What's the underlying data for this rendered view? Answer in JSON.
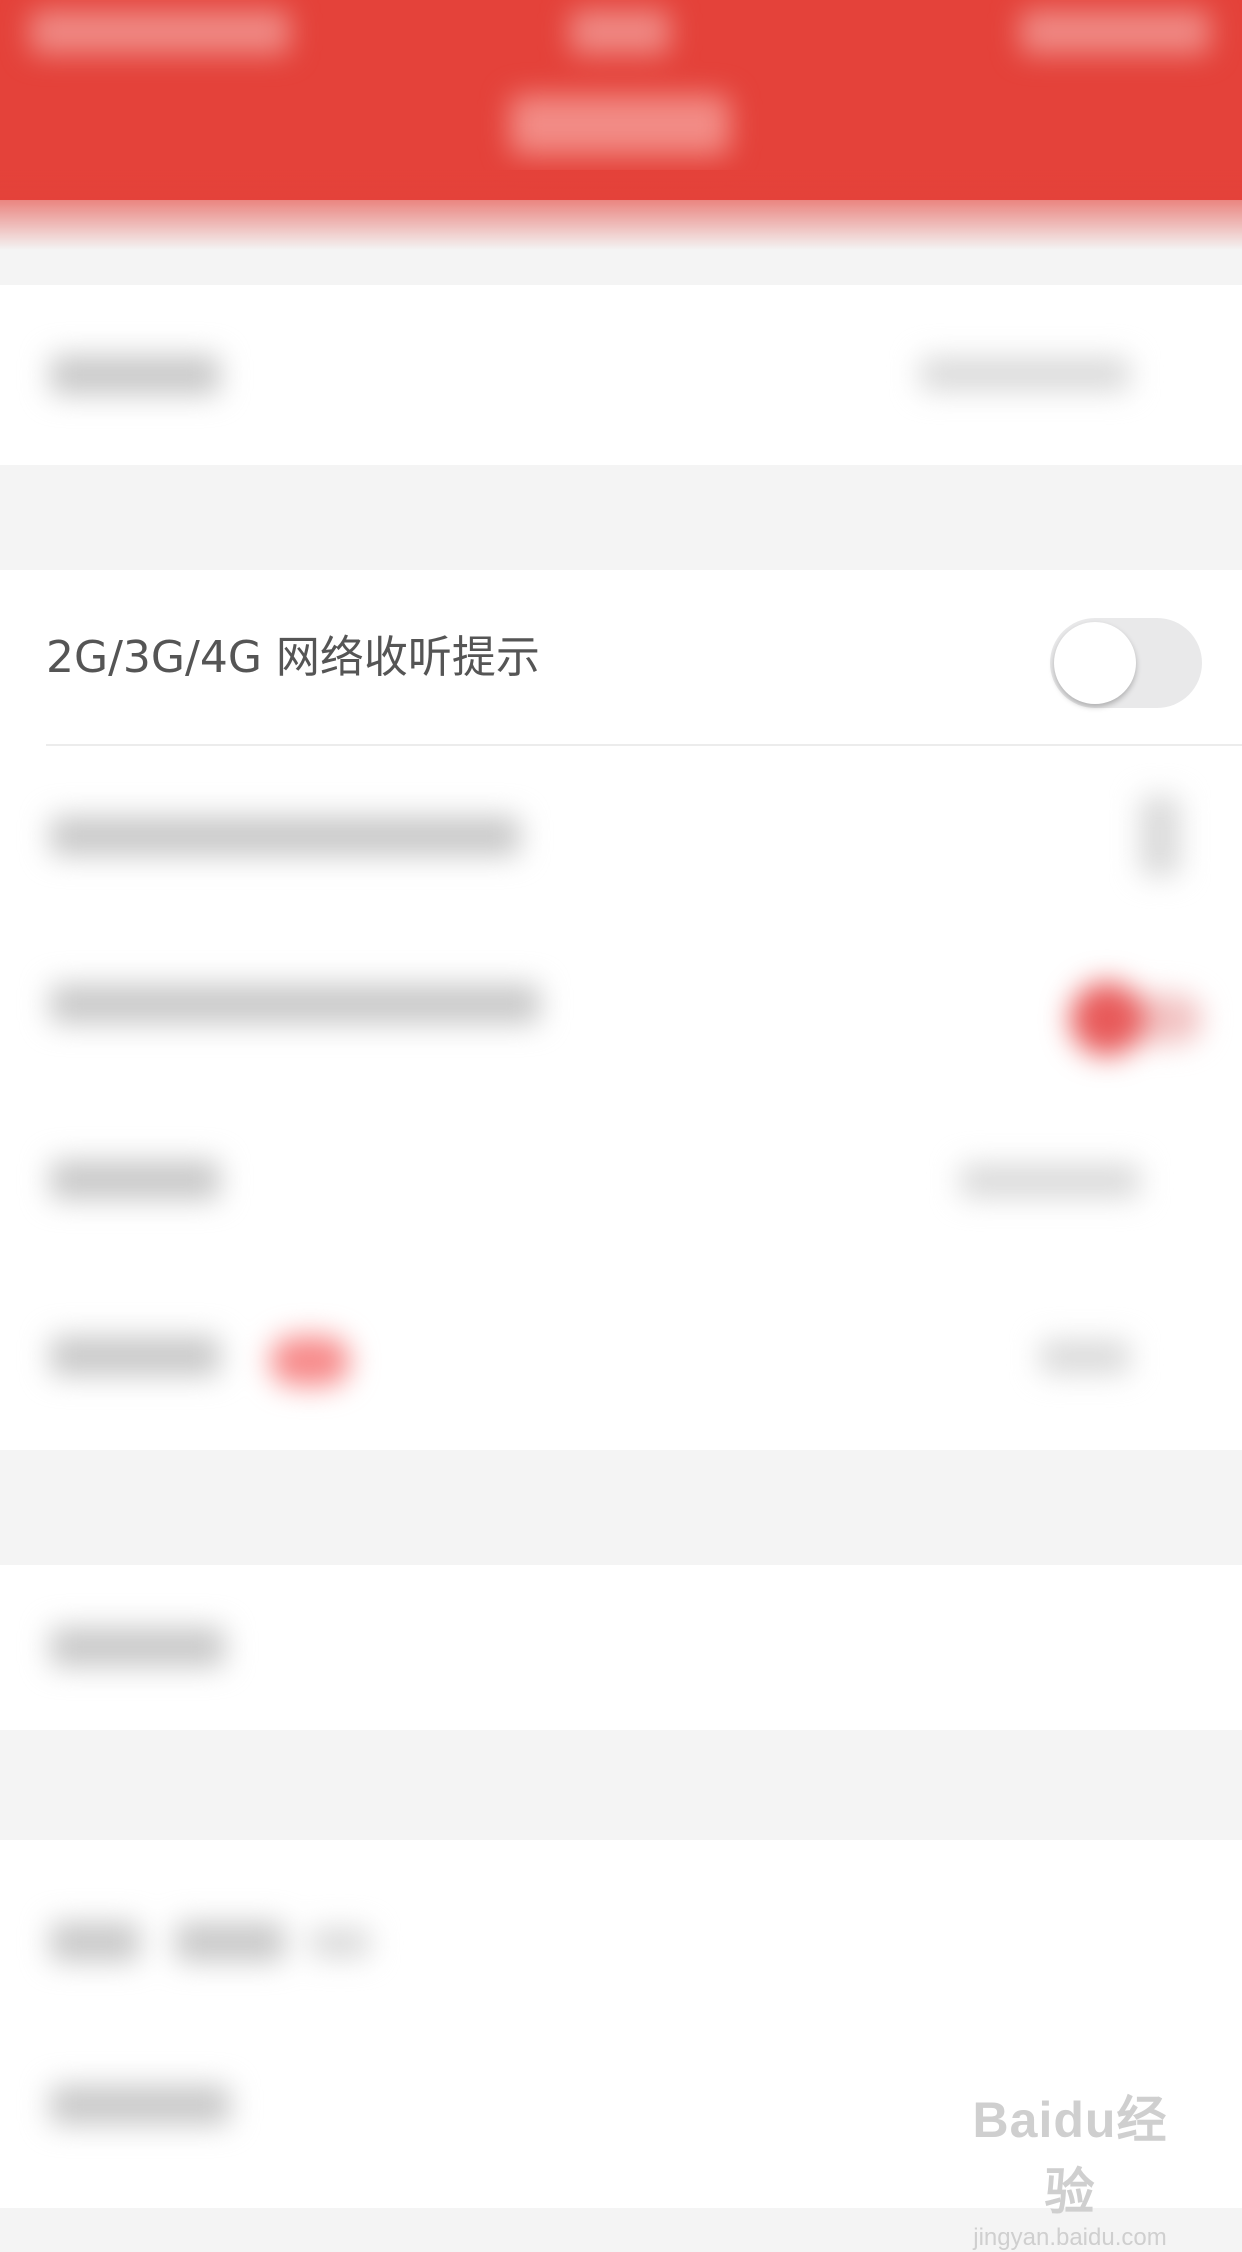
{
  "setting": {
    "label": "2G/3G/4G 网络收听提示",
    "toggle_on": false
  },
  "watermark": {
    "brand": "Baidu经验",
    "domain": "jingyan.baidu.com"
  },
  "colors": {
    "header": "#e4423a",
    "accent": "#e85a5a",
    "toggle_off_track": "#e9e9ea"
  }
}
